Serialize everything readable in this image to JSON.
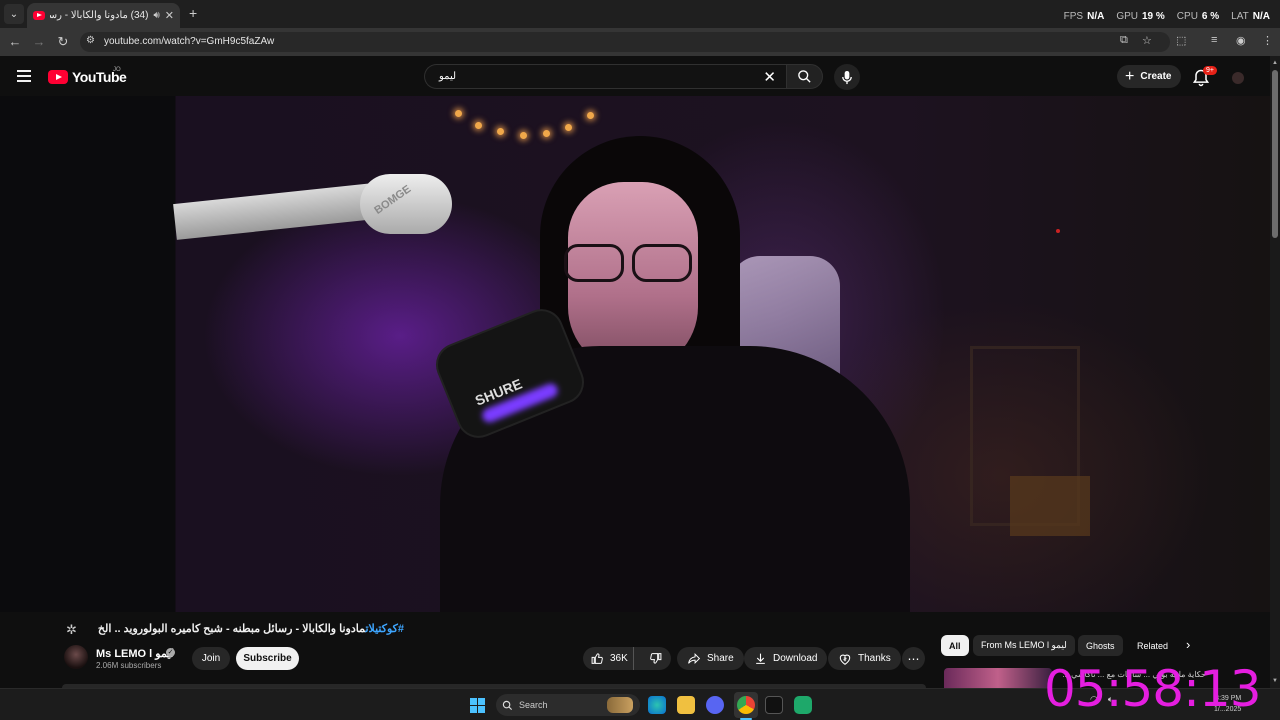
{
  "browser": {
    "tab_title": "(34) مادونا والكابالا - رسائل ...",
    "new_tab_symbol": "+",
    "url": "youtube.com/watch?v=GmH9c5faZAw",
    "perf": [
      {
        "label": "FPS",
        "value": "N/A"
      },
      {
        "label": "GPU",
        "value": "19 %"
      },
      {
        "label": "CPU",
        "value": "6 %"
      },
      {
        "label": "LAT",
        "value": "N/A"
      }
    ]
  },
  "youtube": {
    "logo_text": "YouTube",
    "country_code": "JO",
    "search_value": "ليمو",
    "create_label": "Create",
    "notification_badge": "9+"
  },
  "video_scene": {
    "mount_brand": "BOMGE",
    "mic_brand": "SHURE"
  },
  "watch": {
    "hashtag": "#كوكتيلات",
    "title": "مادونا والكابالا - رسائل مبطنه - شبح كاميره البولورويد .. الخ",
    "channel_name": "Ms LEMO l ليمو",
    "subscribers": "2.06M subscribers",
    "join_label": "Join",
    "subscribe_label": "Subscribe",
    "like_count": "36K",
    "share_label": "Share",
    "download_label": "Download",
    "thanks_label": "Thanks"
  },
  "chips": [
    "All",
    "From Ms LEMO l ليمو",
    "Ghosts",
    "Related"
  ],
  "recommendation": {
    "title": "حكاية مانيه بوبي ... ساعات مع ... تاكاشي ..."
  },
  "taskbar": {
    "search_placeholder": "Search",
    "clock_time": "3:39 PM",
    "clock_date": "1/...2025"
  },
  "overlay": {
    "timer": "05:58:13"
  }
}
